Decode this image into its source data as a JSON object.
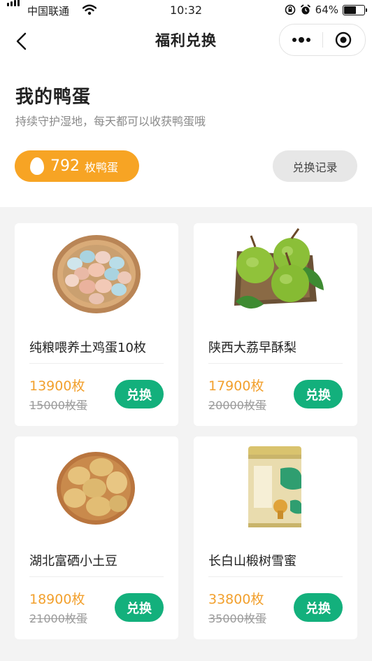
{
  "status_bar": {
    "carrier": "中国联通",
    "time": "10:32",
    "battery": "64%",
    "battery_level": 0.64
  },
  "nav": {
    "title": "福利兑换"
  },
  "header": {
    "title": "我的鸭蛋",
    "subtitle": "持续守护湿地，每天都可以收获鸭蛋哦"
  },
  "balance": {
    "count": "792",
    "unit": "枚鸭蛋"
  },
  "records_label": "兑换记录",
  "products": [
    {
      "name": "纯粮喂养土鸡蛋10枚",
      "price": "13900枚",
      "original_price": "15000枚蛋",
      "button": "兑换",
      "image": "egg-basket-image"
    },
    {
      "name": "陕西大荔早酥梨",
      "price": "17900枚",
      "original_price": "20000枚蛋",
      "button": "兑换",
      "image": "pears-image"
    },
    {
      "name": "湖北富硒小土豆",
      "price": "18900枚",
      "original_price": "21000枚蛋",
      "button": "兑换",
      "image": "potatoes-image"
    },
    {
      "name": "长白山椴树雪蜜",
      "price": "33800枚",
      "original_price": "35000枚蛋",
      "button": "兑换",
      "image": "honey-jar-image"
    }
  ],
  "colors": {
    "accent_orange": "#f7a424",
    "button_green": "#13b07c",
    "price_orange": "#f2a02d"
  }
}
